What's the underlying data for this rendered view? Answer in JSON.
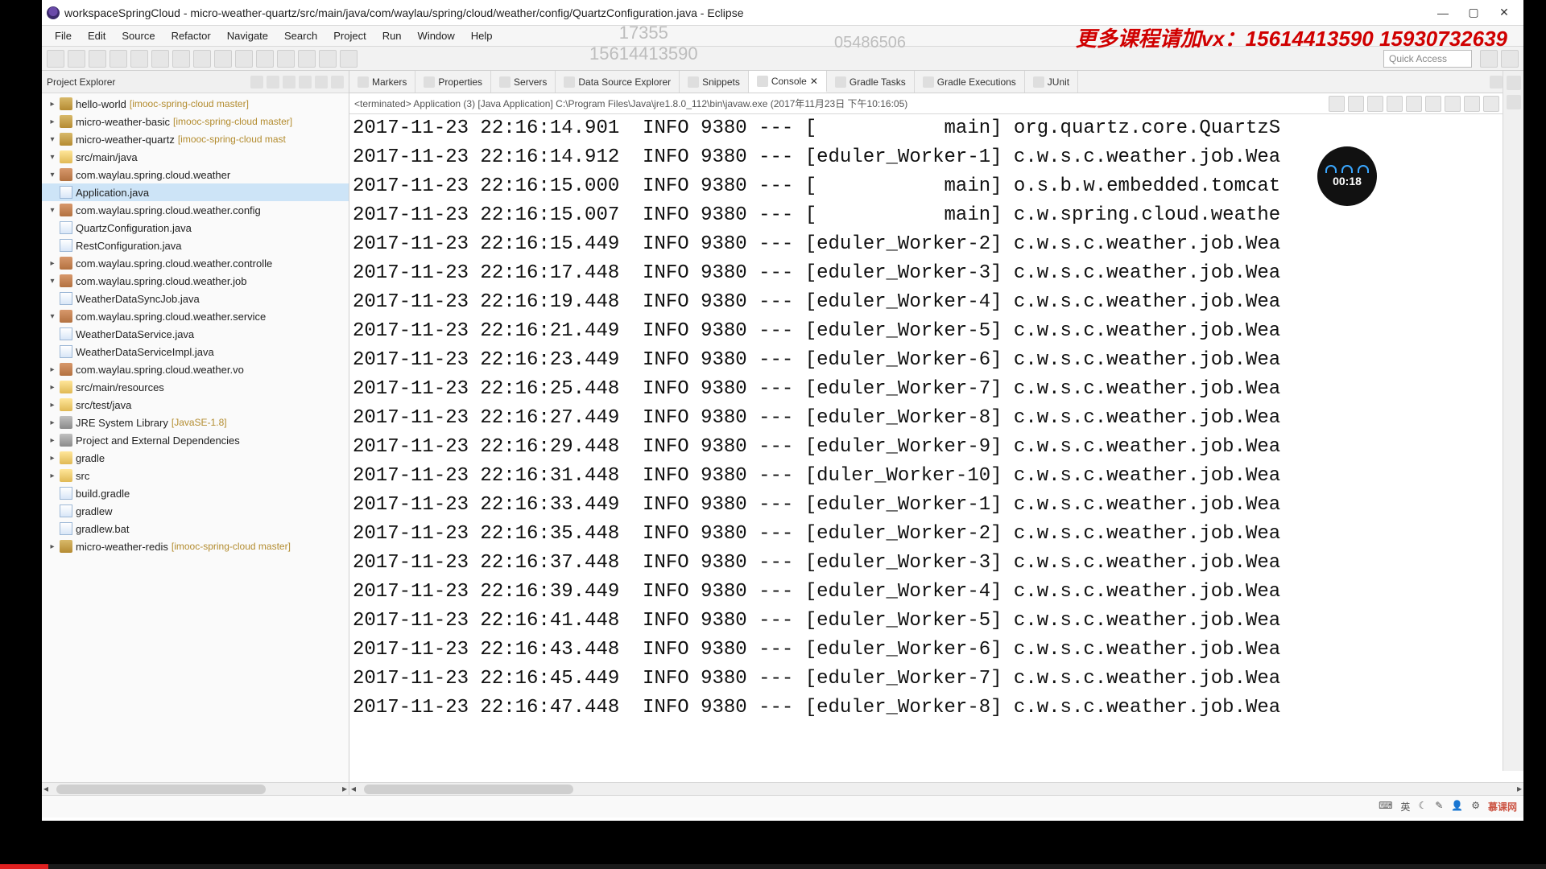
{
  "window": {
    "title": "workspaceSpringCloud - micro-weather-quartz/src/main/java/com/waylau/spring/cloud/weather/config/QuartzConfiguration.java - Eclipse"
  },
  "menu": [
    "File",
    "Edit",
    "Source",
    "Refactor",
    "Navigate",
    "Search",
    "Project",
    "Run",
    "Window",
    "Help"
  ],
  "quick_access": "Quick Access",
  "sidebar": {
    "title": "Project Explorer",
    "tree": [
      {
        "depth": 0,
        "exp": "▸",
        "icon": "proj",
        "label": "hello-world",
        "repo": "[imooc-spring-cloud master]"
      },
      {
        "depth": 0,
        "exp": "▸",
        "icon": "proj",
        "label": "micro-weather-basic",
        "repo": "[imooc-spring-cloud master]"
      },
      {
        "depth": 0,
        "exp": "▾",
        "icon": "proj",
        "label": "micro-weather-quartz",
        "repo": "[imooc-spring-cloud mast"
      },
      {
        "depth": 1,
        "exp": "▾",
        "icon": "folder",
        "label": "src/main/java"
      },
      {
        "depth": 2,
        "exp": "▾",
        "icon": "pkg",
        "label": "com.waylau.spring.cloud.weather"
      },
      {
        "depth": 3,
        "exp": "",
        "icon": "file",
        "label": "Application.java",
        "selected": true
      },
      {
        "depth": 2,
        "exp": "▾",
        "icon": "pkg",
        "label": "com.waylau.spring.cloud.weather.config"
      },
      {
        "depth": 3,
        "exp": "",
        "icon": "file",
        "label": "QuartzConfiguration.java"
      },
      {
        "depth": 3,
        "exp": "",
        "icon": "file",
        "label": "RestConfiguration.java"
      },
      {
        "depth": 2,
        "exp": "▸",
        "icon": "pkg",
        "label": "com.waylau.spring.cloud.weather.controlle"
      },
      {
        "depth": 2,
        "exp": "▾",
        "icon": "pkg",
        "label": "com.waylau.spring.cloud.weather.job"
      },
      {
        "depth": 3,
        "exp": "",
        "icon": "file",
        "label": "WeatherDataSyncJob.java"
      },
      {
        "depth": 2,
        "exp": "▾",
        "icon": "pkg",
        "label": "com.waylau.spring.cloud.weather.service"
      },
      {
        "depth": 3,
        "exp": "",
        "icon": "file",
        "label": "WeatherDataService.java"
      },
      {
        "depth": 3,
        "exp": "",
        "icon": "file",
        "label": "WeatherDataServiceImpl.java"
      },
      {
        "depth": 2,
        "exp": "▸",
        "icon": "pkg",
        "label": "com.waylau.spring.cloud.weather.vo"
      },
      {
        "depth": 1,
        "exp": "▸",
        "icon": "folder",
        "label": "src/main/resources"
      },
      {
        "depth": 1,
        "exp": "▸",
        "icon": "folder",
        "label": "src/test/java"
      },
      {
        "depth": 1,
        "exp": "▸",
        "icon": "jar",
        "label": "JRE System Library",
        "repo": "[JavaSE-1.8]"
      },
      {
        "depth": 1,
        "exp": "▸",
        "icon": "jar",
        "label": "Project and External Dependencies"
      },
      {
        "depth": 1,
        "exp": "▸",
        "icon": "folder",
        "label": "gradle"
      },
      {
        "depth": 1,
        "exp": "▸",
        "icon": "folder",
        "label": "src"
      },
      {
        "depth": 1,
        "exp": "",
        "icon": "file",
        "label": "build.gradle"
      },
      {
        "depth": 1,
        "exp": "",
        "icon": "file",
        "label": "gradlew"
      },
      {
        "depth": 1,
        "exp": "",
        "icon": "file",
        "label": "gradlew.bat"
      },
      {
        "depth": 0,
        "exp": "▸",
        "icon": "proj",
        "label": "micro-weather-redis",
        "repo": "[imooc-spring-cloud master]"
      }
    ]
  },
  "tabs": [
    {
      "label": "Markers"
    },
    {
      "label": "Properties"
    },
    {
      "label": "Servers"
    },
    {
      "label": "Data Source Explorer"
    },
    {
      "label": "Snippets"
    },
    {
      "label": "Console",
      "active": true,
      "close": true
    },
    {
      "label": "Gradle Tasks"
    },
    {
      "label": "Gradle Executions"
    },
    {
      "label": "JUnit"
    }
  ],
  "console_status": "<terminated> Application (3) [Java Application] C:\\Program Files\\Java\\jre1.8.0_112\\bin\\javaw.exe (2017年11月23日 下午10:16:05)",
  "console_lines": [
    "2017-11-23 22:16:14.901  INFO 9380 --- [           main] org.quartz.core.QuartzS",
    "2017-11-23 22:16:14.912  INFO 9380 --- [eduler_Worker-1] c.w.s.c.weather.job.Wea",
    "2017-11-23 22:16:15.000  INFO 9380 --- [           main] o.s.b.w.embedded.tomcat",
    "2017-11-23 22:16:15.007  INFO 9380 --- [           main] c.w.spring.cloud.weathe",
    "2017-11-23 22:16:15.449  INFO 9380 --- [eduler_Worker-2] c.w.s.c.weather.job.Wea",
    "2017-11-23 22:16:17.448  INFO 9380 --- [eduler_Worker-3] c.w.s.c.weather.job.Wea",
    "2017-11-23 22:16:19.448  INFO 9380 --- [eduler_Worker-4] c.w.s.c.weather.job.Wea",
    "2017-11-23 22:16:21.449  INFO 9380 --- [eduler_Worker-5] c.w.s.c.weather.job.Wea",
    "2017-11-23 22:16:23.449  INFO 9380 --- [eduler_Worker-6] c.w.s.c.weather.job.Wea",
    "2017-11-23 22:16:25.448  INFO 9380 --- [eduler_Worker-7] c.w.s.c.weather.job.Wea",
    "2017-11-23 22:16:27.449  INFO 9380 --- [eduler_Worker-8] c.w.s.c.weather.job.Wea",
    "2017-11-23 22:16:29.448  INFO 9380 --- [eduler_Worker-9] c.w.s.c.weather.job.Wea",
    "2017-11-23 22:16:31.448  INFO 9380 --- [duler_Worker-10] c.w.s.c.weather.job.Wea",
    "2017-11-23 22:16:33.449  INFO 9380 --- [eduler_Worker-1] c.w.s.c.weather.job.Wea",
    "2017-11-23 22:16:35.448  INFO 9380 --- [eduler_Worker-2] c.w.s.c.weather.job.Wea",
    "2017-11-23 22:16:37.448  INFO 9380 --- [eduler_Worker-3] c.w.s.c.weather.job.Wea",
    "2017-11-23 22:16:39.449  INFO 9380 --- [eduler_Worker-4] c.w.s.c.weather.job.Wea",
    "2017-11-23 22:16:41.448  INFO 9380 --- [eduler_Worker-5] c.w.s.c.weather.job.Wea",
    "2017-11-23 22:16:43.448  INFO 9380 --- [eduler_Worker-6] c.w.s.c.weather.job.Wea",
    "2017-11-23 22:16:45.449  INFO 9380 --- [eduler_Worker-7] c.w.s.c.weather.job.Wea",
    "2017-11-23 22:16:47.448  INFO 9380 --- [eduler_Worker-8] c.w.s.c.weather.job.Wea"
  ],
  "overlay": {
    "ad": "更多课程请加vx：15614413590  15930732639",
    "num1a": "17355",
    "num1b": "15614413590",
    "num2": "05486506"
  },
  "badge_time": "00:18",
  "status": {
    "ime": "英",
    "brand": "慕课网"
  }
}
